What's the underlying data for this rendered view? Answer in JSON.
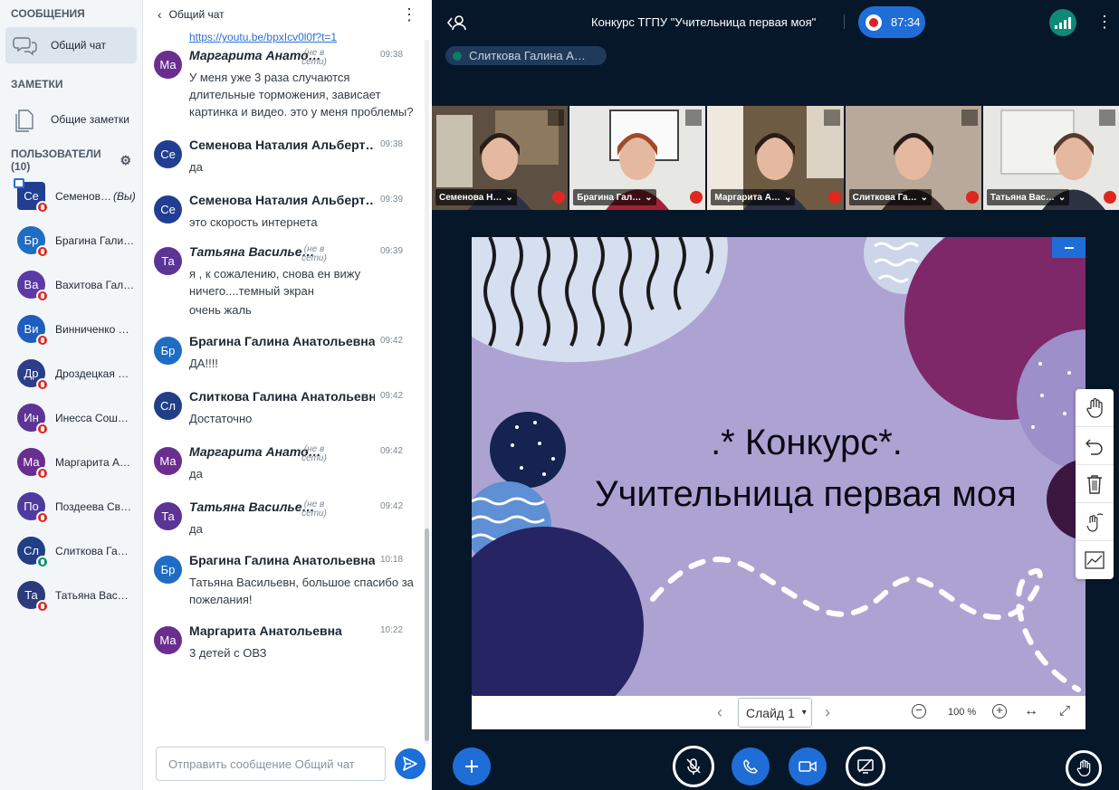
{
  "sidebar": {
    "messages_title": "СООБЩЕНИЯ",
    "public_chat": "Общий чат",
    "notes_title": "ЗАМЕТКИ",
    "shared_notes": "Общие заметки",
    "users_title": "ПОЛЬЗОВАТЕЛИ (10)",
    "you_suffix": "(Вы)",
    "users": [
      {
        "initials": "Се",
        "name": "Семенов…",
        "color": "#213e92"
      },
      {
        "initials": "Бр",
        "name": "Брагина Гали…",
        "color": "#1f6cc4"
      },
      {
        "initials": "Ва",
        "name": "Вахитова Гал…",
        "color": "#5b3aa6"
      },
      {
        "initials": "Ви",
        "name": "Винниченко …",
        "color": "#1f5ec0"
      },
      {
        "initials": "Др",
        "name": "Дроздецкая …",
        "color": "#2c3d8a"
      },
      {
        "initials": "Ин",
        "name": "Инесса Сош…",
        "color": "#5c3496"
      },
      {
        "initials": "Ма",
        "name": "Маргарита А…",
        "color": "#6a2e8f"
      },
      {
        "initials": "По",
        "name": "Поздеева Св…",
        "color": "#4f3aa0"
      },
      {
        "initials": "Сл",
        "name": "Слиткова Га…",
        "color": "#203f86"
      },
      {
        "initials": "Та",
        "name": "Татьяна Вас…",
        "color": "#2a3a7c"
      }
    ]
  },
  "chat": {
    "title": "Общий чат",
    "link_fragment": "https://youtu.be/bpxIcv0l0f?t=1",
    "offline_label": "(не в сети)",
    "messages": [
      {
        "initials": "Ма",
        "color": "#6a2e8f",
        "name": "Маргарита Анато…",
        "offline": true,
        "time": "09:38",
        "lines": [
          "У меня уже 3 раза случаются длительные торможения, зависает картинка и видео. это у меня проблемы?"
        ]
      },
      {
        "initials": "Се",
        "color": "#213e92",
        "name": "Семенова Наталия Альберт…",
        "offline": false,
        "time": "09:38",
        "lines": [
          "да"
        ]
      },
      {
        "initials": "Се",
        "color": "#213e92",
        "name": "Семенова Наталия Альберт…",
        "offline": false,
        "time": "09:39",
        "lines": [
          "это скорость интернета"
        ]
      },
      {
        "initials": "Та",
        "color": "#5c3496",
        "name": "Татьяна Василье…",
        "offline": true,
        "time": "09:39",
        "lines": [
          "я , к сожалению, снова ен вижу ничего....темный экран",
          "очень жаль"
        ]
      },
      {
        "initials": "Бр",
        "color": "#1f6cc4",
        "name": "Брагина Галина Анатольевна",
        "offline": false,
        "time": "09:42",
        "lines": [
          "ДА!!!!"
        ]
      },
      {
        "initials": "Сл",
        "color": "#203f86",
        "name": "Слиткова Галина Анатольевн",
        "offline": false,
        "time": "09:42",
        "lines": [
          "Достаточно"
        ]
      },
      {
        "initials": "Ма",
        "color": "#6a2e8f",
        "name": "Маргарита Анато…",
        "offline": true,
        "time": "09:42",
        "lines": [
          "да"
        ]
      },
      {
        "initials": "Та",
        "color": "#5c3496",
        "name": "Татьяна Василье…",
        "offline": true,
        "time": "09:42",
        "lines": [
          "да"
        ]
      },
      {
        "initials": "Бр",
        "color": "#1f6cc4",
        "name": "Брагина Галина Анатольевна",
        "offline": false,
        "time": "10:18",
        "lines": [
          "Татьяна Васильевн, большое спасибо за пожелания!"
        ]
      },
      {
        "initials": "Ма",
        "color": "#6a2e8f",
        "name": "Маргарита Анатольевна",
        "offline": false,
        "time": "10:22",
        "lines": [
          "3 детей с ОВЗ"
        ]
      }
    ],
    "input_placeholder": "Отправить сообщение Общий чат"
  },
  "header": {
    "meeting_title": "Конкурс ТГПУ \"Учительница первая моя\"",
    "recording_time": "87:34",
    "talking_user": "Слиткова Галина А…"
  },
  "videos": [
    {
      "name": "Семенова Н…",
      "bg": "#b9c2c8"
    },
    {
      "name": "Брагина Гал…",
      "bg": "#d8d4cf"
    },
    {
      "name": "Маргарита А…",
      "bg": "#c6b8a4"
    },
    {
      "name": "Слиткова Га…",
      "bg": "#cfd0d2"
    },
    {
      "name": "Татьяна Вас…",
      "bg": "#d6dadc"
    }
  ],
  "presentation": {
    "title_line1": ".* Конкурс*.",
    "title_line2": "Учительница первая моя",
    "slide_label": "Слайд 1",
    "zoom": "100 %"
  }
}
